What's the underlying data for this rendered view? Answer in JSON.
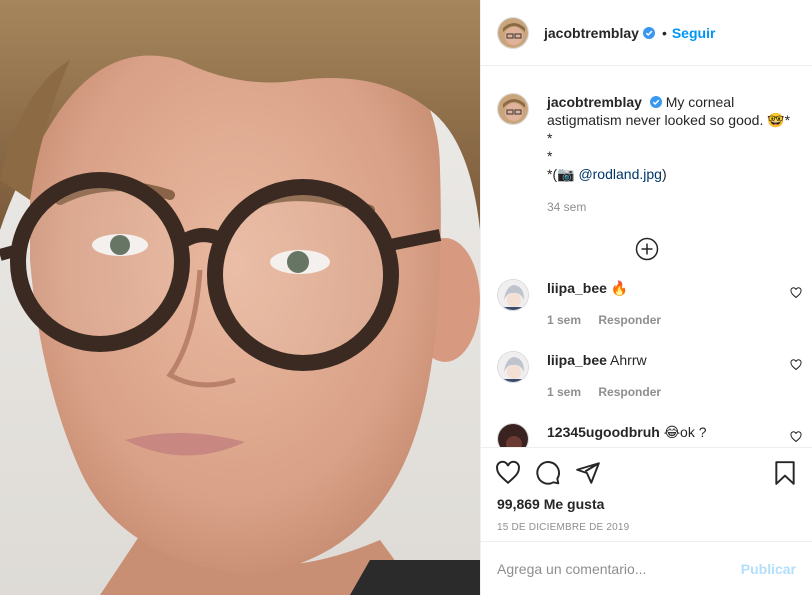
{
  "post": {
    "username": "jacobtremblay",
    "verified": true,
    "follow_separator": "•",
    "follow_label": "Seguir",
    "caption": {
      "username": "jacobtremblay",
      "text": "My corneal astigmatism never looked so good. 🤓*",
      "line2": "*",
      "line3": "*",
      "line4_prefix": "*(📷 ",
      "mention": "@rodland.jpg",
      "line4_suffix": ")",
      "time": "34 sem"
    },
    "load_more_icon": "plus-circle-icon",
    "comments": [
      {
        "username": "liipa_bee",
        "text": "🔥",
        "time": "1 sem",
        "reply_label": "Responder"
      },
      {
        "username": "liipa_bee",
        "text": "Ahrrw",
        "time": "1 sem",
        "reply_label": "Responder"
      },
      {
        "username": "12345ugoodbruh",
        "text": "😂ok ?",
        "time": "",
        "reply_label": ""
      }
    ],
    "likes": "99,869 Me gusta",
    "date": "15 DE DICIEMBRE DE 2019",
    "comment_placeholder": "Agrega un comentario...",
    "publish_label": "Publicar"
  },
  "icons": {
    "like": "heart-icon",
    "comment": "comment-icon",
    "share": "paper-plane-icon",
    "save": "bookmark-icon",
    "verified": "verified-badge-icon"
  },
  "colors": {
    "link_blue": "#0095f6",
    "mention_blue": "#00376b",
    "publish_disabled": "#b2dffc",
    "verified_blue": "#3897f0",
    "muted": "#8e8e8e"
  }
}
